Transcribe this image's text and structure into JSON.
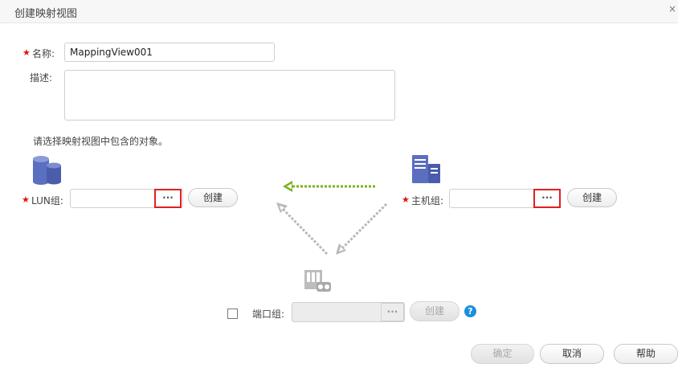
{
  "dialog": {
    "title": "创建映射视图",
    "close_symbol": "×"
  },
  "form": {
    "name_label": "名称:",
    "name_value": "MappingView001",
    "desc_label": "描述:",
    "desc_value": "",
    "hint": "请选择映射视图中包含的对象。"
  },
  "lun": {
    "label": "LUN组:",
    "value": "",
    "browse": "···",
    "create": "创建"
  },
  "host": {
    "label": "主机组:",
    "value": "",
    "browse": "···",
    "create": "创建"
  },
  "port": {
    "label": "端口组:",
    "value": "",
    "browse": "···",
    "create": "创建",
    "checked": false
  },
  "help_symbol": "?",
  "footer": {
    "ok": "确定",
    "cancel": "取消",
    "help": "帮助"
  },
  "colors": {
    "required": "#dd1111",
    "highlight": "#e02020",
    "icon": "#5b6fc0",
    "green_arrow": "#7cb21f",
    "gray_arrow": "#b8b8b8",
    "help": "#1a8fdc"
  }
}
